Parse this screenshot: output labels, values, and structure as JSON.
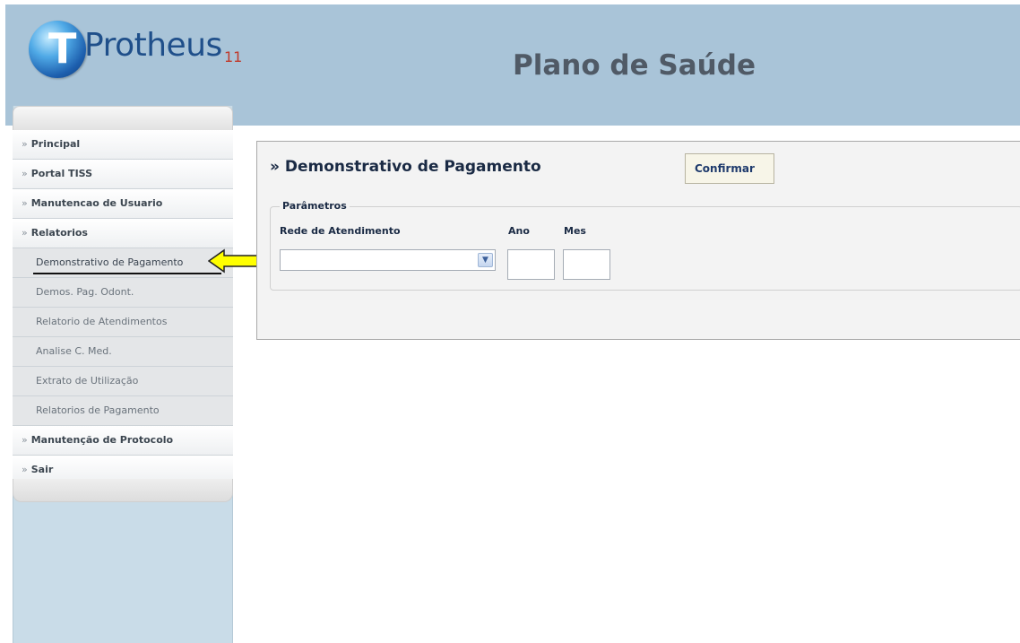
{
  "header": {
    "logo_text": "Protheus",
    "logo_version": "11",
    "logo_letter": "T",
    "title": "Plano de Saúde"
  },
  "sidebar": {
    "chevron": "»",
    "items": [
      {
        "label": "Principal",
        "level": "top"
      },
      {
        "label": "Portal TISS",
        "level": "top"
      },
      {
        "label": "Manutencao de Usuario",
        "level": "top"
      },
      {
        "label": "Relatorios",
        "level": "top"
      },
      {
        "label": "Demonstrativo de Pagamento",
        "level": "sub",
        "active": true
      },
      {
        "label": "Demos. Pag. Odont.",
        "level": "sub"
      },
      {
        "label": "Relatorio de Atendimentos",
        "level": "sub"
      },
      {
        "label": "Analise C. Med.",
        "level": "sub"
      },
      {
        "label": "Extrato de Utilização",
        "level": "sub"
      },
      {
        "label": "Relatorios de Pagamento",
        "level": "sub"
      },
      {
        "label": "Manutenção de Protocolo",
        "level": "top"
      },
      {
        "label": "Sair",
        "level": "top"
      }
    ]
  },
  "form": {
    "title": "» Demonstrativo de Pagamento",
    "legend": "Parâmetros",
    "rede_label": "Rede de Atendimento",
    "rede_value": "",
    "ano_label": "Ano",
    "ano_value": "",
    "mes_label": "Mes",
    "mes_value": "",
    "confirm_label": "Confirmar"
  },
  "colors": {
    "header_bg": "#a9c4d8",
    "sidebar_bg": "#c9dce8",
    "arrow_fill": "#ffff00",
    "title_text": "#505a66"
  }
}
